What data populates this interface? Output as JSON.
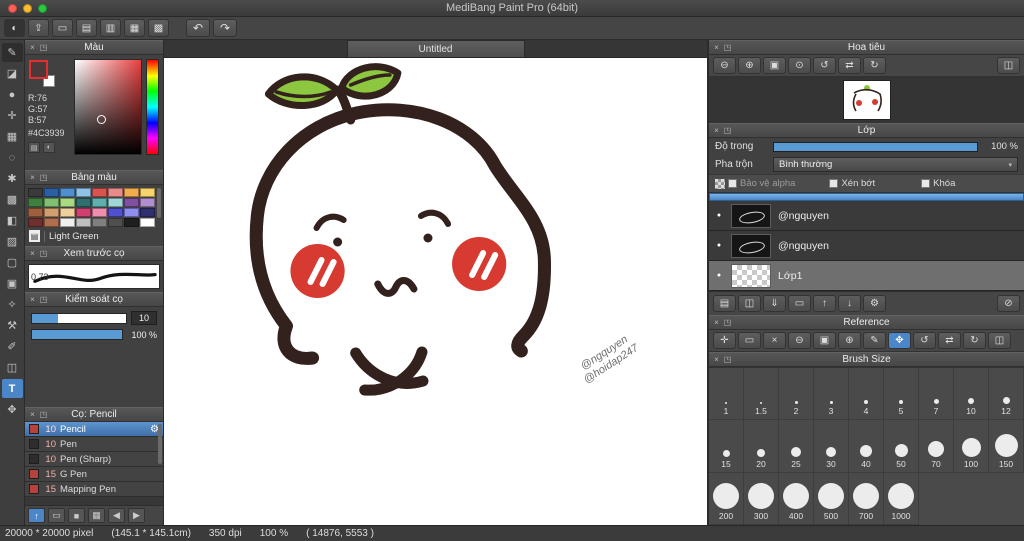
{
  "chrome": {
    "close": "×",
    "popout": "◳"
  },
  "titlebar": {
    "title": "MediBang Paint Pro (64bit)"
  },
  "window_controls": [
    {
      "name": "close-window-button",
      "color": "#ff5f57"
    },
    {
      "name": "minimize-window-button",
      "color": "#febc2e"
    },
    {
      "name": "zoom-window-button",
      "color": "#28c840"
    }
  ],
  "toolbar": {
    "buttons": [
      {
        "name": "brush-mode-button",
        "glyph": "◐",
        "pressed": true
      },
      {
        "name": "publish-button",
        "glyph": "⇪"
      },
      {
        "name": "comment-button",
        "glyph": "▭"
      },
      {
        "name": "new-canvas-button",
        "glyph": "▤"
      },
      {
        "name": "save-button",
        "glyph": "▥"
      },
      {
        "name": "resize-canvas-button",
        "glyph": "▦"
      },
      {
        "name": "material-button",
        "glyph": "▩"
      }
    ],
    "undo": "↶",
    "redo": "↷"
  },
  "tools": [
    {
      "name": "brush-tool",
      "glyph": "✎",
      "pressed": true
    },
    {
      "name": "eraser-tool",
      "glyph": "◪"
    },
    {
      "name": "smudge-tool",
      "glyph": "●"
    },
    {
      "name": "move-tool",
      "glyph": "✛"
    },
    {
      "name": "marquee-select-tool",
      "glyph": "▦"
    },
    {
      "name": "lasso-tool",
      "glyph": "◌"
    },
    {
      "name": "magic-wand-tool",
      "glyph": "✱"
    },
    {
      "name": "pattern-tool",
      "glyph": "▩"
    },
    {
      "name": "bucket-tool",
      "glyph": "◧"
    },
    {
      "name": "gradient-tool",
      "glyph": "▨"
    },
    {
      "name": "select-pen-tool",
      "glyph": "▢"
    },
    {
      "name": "select-eraser-tool",
      "glyph": "▣"
    },
    {
      "name": "eyedropper-tool",
      "glyph": "✧"
    },
    {
      "name": "operation-tool",
      "glyph": "⚒"
    },
    {
      "name": "control-point-tool",
      "glyph": "✐"
    },
    {
      "name": "divide-tool",
      "glyph": "◫"
    },
    {
      "name": "text-tool",
      "glyph": "T",
      "active": true
    },
    {
      "name": "hand-tool",
      "glyph": "✥"
    }
  ],
  "color_panel": {
    "title": "Màu",
    "r": "R:76",
    "g": "G:57",
    "b": "B:57",
    "hex": "#4C3939",
    "current": "#4C3939",
    "icon1": "▤",
    "icon2": "◐"
  },
  "palette_panel": {
    "title": "Bảng màu",
    "doc_icon": "▤",
    "selected_name": "Light Green",
    "swatches": [
      "#3a3a3a",
      "#2b5fa3",
      "#4f8fd0",
      "#8fc3e8",
      "#d9534f",
      "#e98b8b",
      "#f0ad4e",
      "#f7d36b",
      "#3f7f3f",
      "#7fbf6f",
      "#a9d980",
      "#2f6f6f",
      "#5fafaf",
      "#9fd7d7",
      "#7f4fa0",
      "#b08fd0",
      "#9f5f3f",
      "#cf9f6f",
      "#efcf9f",
      "#cf3f6f",
      "#ef8fb0",
      "#4f4fcf",
      "#8f8fef",
      "#2f2f6f",
      "#6f2f2f",
      "#af6f4f",
      "#efefef",
      "#bfbfbf",
      "#7f7f7f",
      "#4f4f4f",
      "#1f1f1f",
      "#ffffff"
    ]
  },
  "preview_panel": {
    "title": "Xem trước cọ",
    "value": "0.73"
  },
  "control_panel": {
    "title": "Kiểm soát cọ",
    "size": "10",
    "size_fill": "28%",
    "opacity": "100 %",
    "opacity_fill": "100%"
  },
  "brush_panel": {
    "title": "Cọ: Pencil",
    "items": [
      {
        "chip": "#b8413b",
        "size": "10",
        "name": "Pencil",
        "selected": true,
        "gear": "⚙"
      },
      {
        "chip": "#2d2d2d",
        "size": "10",
        "name": "Pen"
      },
      {
        "chip": "#2d2d2d",
        "size": "10",
        "name": "Pen (Sharp)"
      },
      {
        "chip": "#b8413b",
        "size": "15",
        "name": "G Pen"
      },
      {
        "chip": "#b8413b",
        "size": "15",
        "name": "Mapping Pen"
      }
    ]
  },
  "left_bottom_bar": [
    {
      "name": "dock-up-button",
      "glyph": "↑",
      "active": true
    },
    {
      "name": "brush-folder-button",
      "glyph": "▭"
    },
    {
      "name": "foreground-swatch-button",
      "glyph": "■"
    },
    {
      "name": "grid-toggle-button",
      "glyph": "▦"
    },
    {
      "name": "prev-brush-button",
      "glyph": "◀"
    },
    {
      "name": "next-brush-button",
      "glyph": "▶"
    }
  ],
  "canvas": {
    "tab": "Untitled",
    "signature_line1": "@ngquyen",
    "signature_line2": "@hoidap247"
  },
  "navigator_panel": {
    "title": "Hoa tiêu",
    "buttons": [
      {
        "name": "nav-zoom-out-button",
        "glyph": "⊖"
      },
      {
        "name": "nav-zoom-in-button",
        "glyph": "⊕"
      },
      {
        "name": "nav-fit-button",
        "glyph": "▣"
      },
      {
        "name": "nav-actual-size-button",
        "glyph": "⊙"
      },
      {
        "name": "nav-rotate-left-button",
        "glyph": "↺"
      },
      {
        "name": "nav-flip-button",
        "glyph": "⇄"
      },
      {
        "name": "nav-rotate-right-button",
        "glyph": "↻"
      },
      {
        "name": "nav-reset-button",
        "glyph": "◫"
      }
    ]
  },
  "layers_panel": {
    "title": "Lớp",
    "opacity_label": "Độ trong",
    "opacity_value": "100 %",
    "blend_label": "Pha trộn",
    "blend_value": "Bình thường",
    "blend_caret": "▾",
    "alpha_label": "Bảo vệ alpha",
    "clip_label": "Xén bớt",
    "lock_label": "Khóa",
    "layers": [
      {
        "name": "@ngquyen",
        "thumb": "dark",
        "vis": "●"
      },
      {
        "name": "@ngquyen",
        "thumb": "dark",
        "vis": "●"
      },
      {
        "name": "Lớp1",
        "thumb": "checker",
        "vis": "●",
        "selected": true
      }
    ],
    "buttons": [
      {
        "name": "add-layer-button",
        "glyph": "▤"
      },
      {
        "name": "duplicate-layer-button",
        "glyph": "◫"
      },
      {
        "name": "merge-down-button",
        "glyph": "⇓"
      },
      {
        "name": "layer-folder-button",
        "glyph": "▭"
      },
      {
        "name": "move-layer-up-button",
        "glyph": "↑"
      },
      {
        "name": "move-layer-down-button",
        "glyph": "↓"
      },
      {
        "name": "layer-settings-button",
        "glyph": "⚙"
      },
      {
        "name": "delete-layer-button",
        "glyph": "⊘"
      }
    ]
  },
  "reference_panel": {
    "title": "Reference",
    "buttons": [
      {
        "name": "ref-anchor-button",
        "glyph": "✛"
      },
      {
        "name": "ref-folder-button",
        "glyph": "▭"
      },
      {
        "name": "ref-close-button",
        "glyph": "×"
      },
      {
        "name": "ref-zoom-out-button",
        "glyph": "⊖"
      },
      {
        "name": "ref-fit-button",
        "glyph": "▣"
      },
      {
        "name": "ref-zoom-in-button",
        "glyph": "⊕"
      },
      {
        "name": "ref-pencil-button",
        "glyph": "✎"
      },
      {
        "name": "ref-hand-button",
        "glyph": "✥",
        "active": true
      },
      {
        "name": "ref-rotate-left-button",
        "glyph": "↺"
      },
      {
        "name": "ref-flip-button",
        "glyph": "⇄"
      },
      {
        "name": "ref-rotate-right-button",
        "glyph": "↻"
      },
      {
        "name": "ref-copy-button",
        "glyph": "◫"
      }
    ]
  },
  "brush_size_panel": {
    "title": "Brush Size",
    "sizes": [
      "1",
      "1.5",
      "2",
      "3",
      "4",
      "5",
      "7",
      "10",
      "12",
      "15",
      "20",
      "25",
      "30",
      "40",
      "50",
      "70",
      "100",
      "150",
      "200",
      "300",
      "400",
      "500",
      "700",
      "1000"
    ]
  },
  "statusbar": {
    "size": "20000 * 20000 pixel",
    "dims": "(145.1 * 145.1cm)",
    "dpi": "350 dpi",
    "zoom": "100 %",
    "coords": "( 14876, 5553 )"
  }
}
